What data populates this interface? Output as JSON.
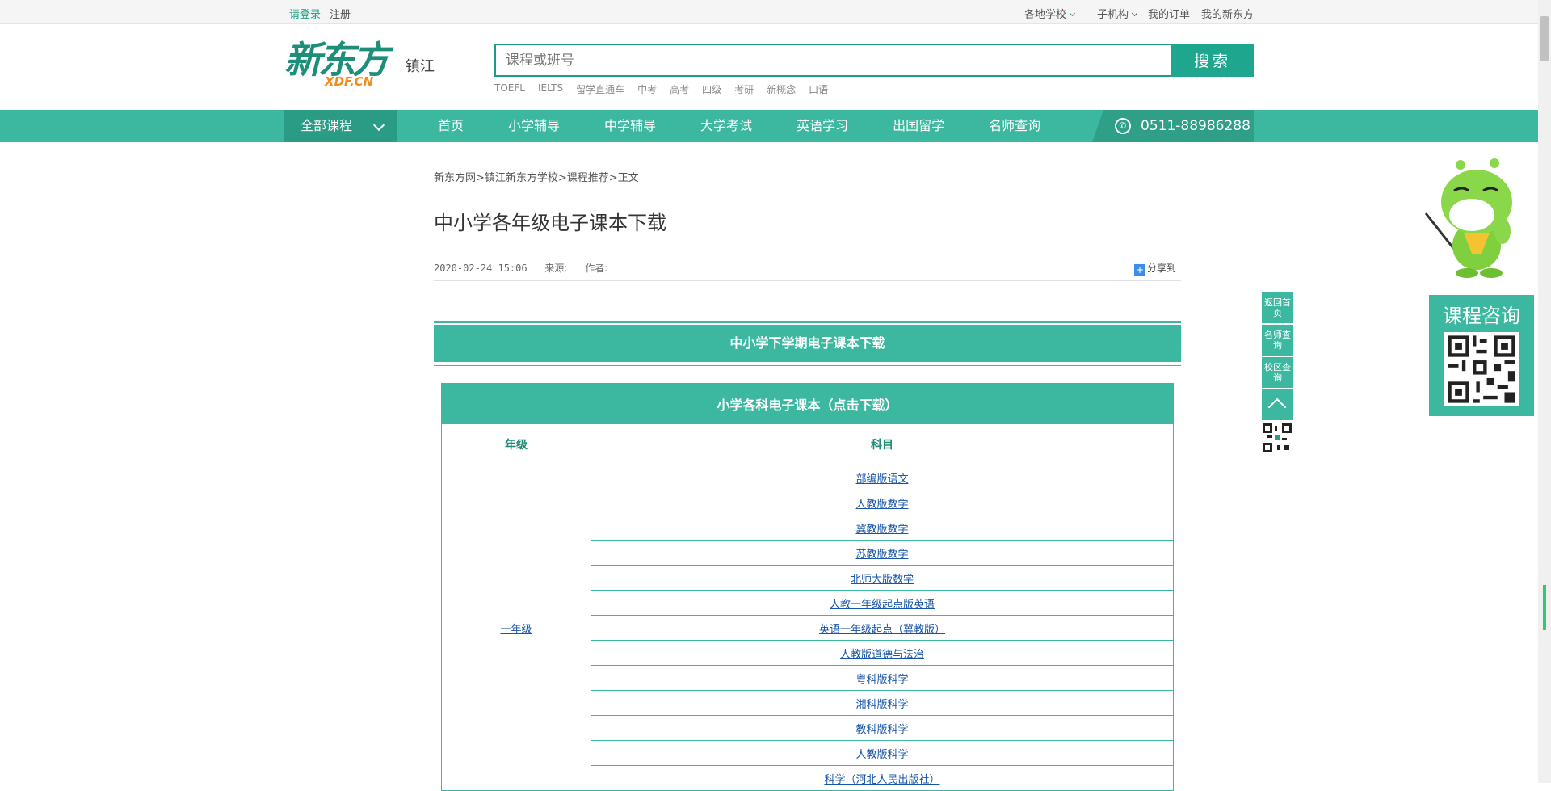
{
  "topbar": {
    "login": "请登录",
    "register": "注册",
    "schools": "各地学校",
    "sub_org": "子机构",
    "orders": "我的订单",
    "my_xdf": "我的新东方"
  },
  "header": {
    "logo_cn": "新东方",
    "logo_en": "XDF.CN",
    "city": "镇江",
    "search_placeholder": "课程或班号",
    "search_button": "搜索",
    "hotwords": [
      "TOEFL",
      "IELTS",
      "留学直通车",
      "中考",
      "高考",
      "四级",
      "考研",
      "新概念",
      "口语"
    ]
  },
  "nav": {
    "all_courses": "全部课程",
    "items": [
      "首页",
      "小学辅导",
      "中学辅导",
      "大学考试",
      "英语学习",
      "出国留学",
      "名师查询"
    ],
    "phone": "0511-88986288"
  },
  "article": {
    "breadcrumb": "新东方网>镇江新东方学校>课程推荐>正文",
    "title": "中小学各年级电子课本下载",
    "date": "2020-02-24 15:06",
    "source_label": "来源:",
    "author_label": "作者:",
    "share": "分享到",
    "banner": "中小学下学期电子课本下载"
  },
  "table": {
    "caption": "小学各科电子课本（点击下载）",
    "col_grade": "年级",
    "col_subject": "科目",
    "grade": "一年级",
    "subjects": [
      "部编版语文",
      "人教版数学",
      "冀教版数学",
      "苏教版数学",
      "北师大版数学",
      "人教一年级起点版英语",
      "英语一年级起点（冀教版）",
      "人教版道德与法治",
      "粤科版科学",
      "湘科版科学",
      "教科版科学",
      "人教版科学",
      "科学（河北人民出版社）"
    ]
  },
  "side": {
    "home": "返回首页",
    "teachers": "名师查询",
    "campus": "校区查询",
    "consult": "课程咨询"
  },
  "colors": {
    "brand": "#3cb8a0",
    "brand_dark": "#2a9b85",
    "link": "#1755a8",
    "logo_orange": "#f08c1e"
  }
}
